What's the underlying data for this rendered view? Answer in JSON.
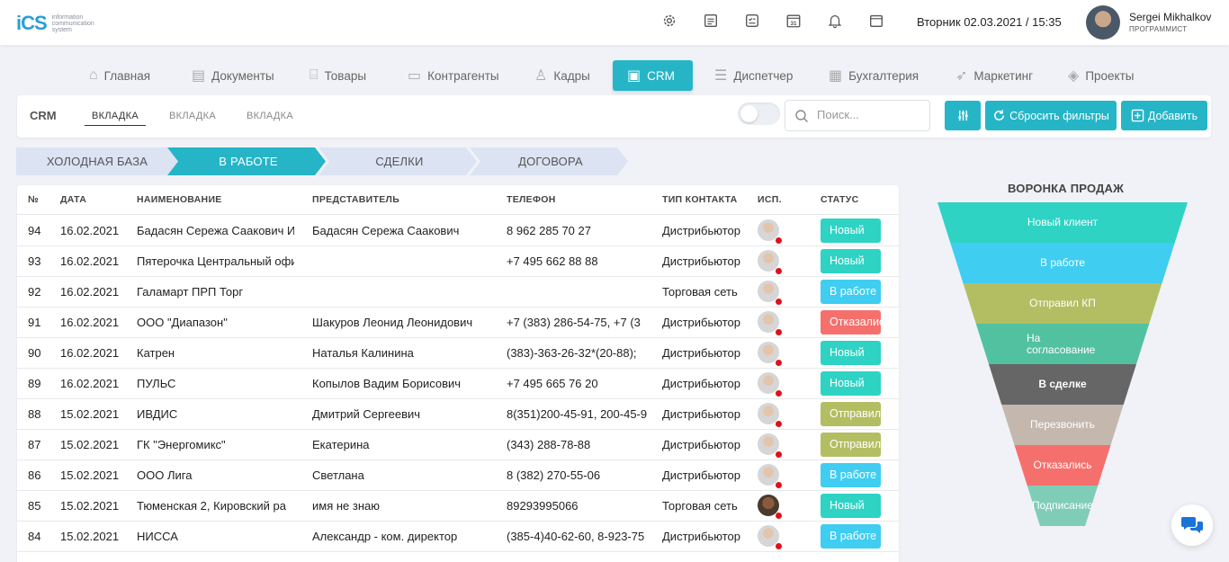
{
  "header": {
    "logo_mark": "iCS",
    "logo_lines": [
      "information",
      "communication",
      "system"
    ],
    "icons": [
      "settings-icon",
      "document-icon",
      "checklist-icon",
      "calendar-icon",
      "bell-icon",
      "window-icon"
    ],
    "calendar_day": "31",
    "datetime": "Вторник 02.03.2021 / 15:35",
    "user_name": "Sergei Mikhalkov",
    "user_role": "ПРОГРАММИСТ"
  },
  "nav": {
    "items": [
      {
        "label": "Главная",
        "icon": "home-icon"
      },
      {
        "label": "Документы",
        "icon": "documents-icon"
      },
      {
        "label": "Товары",
        "icon": "box-icon"
      },
      {
        "label": "Контрагенты",
        "icon": "briefcase-icon"
      },
      {
        "label": "Кадры",
        "icon": "people-icon"
      },
      {
        "label": "CRM",
        "icon": "monitor-icon",
        "active": true
      },
      {
        "label": "Диспетчер",
        "icon": "list-icon"
      },
      {
        "label": "Бухгалтерия",
        "icon": "calculator-icon"
      },
      {
        "label": "Маркетинг",
        "icon": "rocket-icon"
      },
      {
        "label": "Проекты",
        "icon": "layers-icon"
      }
    ]
  },
  "toolbar": {
    "title": "CRM",
    "tabs": [
      "ВКЛАДКА",
      "ВКЛАДКА",
      "ВКЛАДКА"
    ],
    "search_placeholder": "Поиск...",
    "reset_label": "Сбросить фильтры",
    "add_label": "Добавить"
  },
  "stages": [
    "ХОЛОДНАЯ БАЗА",
    "В РАБОТЕ",
    "СДЕЛКИ",
    "ДОГОВОРА"
  ],
  "table": {
    "columns": [
      "№",
      "ДАТА",
      "НАИМЕНОВАНИЕ",
      "ПРЕДСТАВИТЕЛЬ",
      "ТЕЛЕФОН",
      "ТИП КОНТАКТА",
      "ИСП.",
      "СТАТУС"
    ],
    "rows": [
      {
        "no": "94",
        "date": "16.02.2021",
        "name": "Бадасян Сережа Саакович И",
        "rep": "Бадасян Сережа Саакович",
        "phone": "8 962 285 70 27",
        "type": "Дистрибьютор",
        "status": "Новый",
        "status_color": "#2ed3c4"
      },
      {
        "no": "93",
        "date": "16.02.2021",
        "name": "Пятерочка Центральный офи",
        "rep": "",
        "phone": "+7 495 662 88 88",
        "type": "Дистрибьютор",
        "status": "Новый",
        "status_color": "#2ed3c4"
      },
      {
        "no": "92",
        "date": "16.02.2021",
        "name": "Галамарт ПРП Торг",
        "rep": "",
        "phone": "",
        "type": "Торговая сеть",
        "status": "В работе",
        "status_color": "#3fcdf1"
      },
      {
        "no": "91",
        "date": "16.02.2021",
        "name": "ООО \"Диапазон\"",
        "rep": "Шакуров Леонид Леонидович",
        "phone": "+7 (383) 286-54-75, +7 (3",
        "type": "Дистрибьютор",
        "status": "Отказались",
        "status_color": "#f5706c"
      },
      {
        "no": "90",
        "date": "16.02.2021",
        "name": "Катрен",
        "rep": "Наталья Калинина",
        "phone": "(383)-363-26-32*(20-88);",
        "type": "Дистрибьютор",
        "status": "Новый",
        "status_color": "#2ed3c4"
      },
      {
        "no": "89",
        "date": "16.02.2021",
        "name": "ПУЛЬС",
        "rep": "Копылов Вадим Борисович",
        "phone": "+7 495 665 76 20",
        "type": "Дистрибьютор",
        "status": "Новый",
        "status_color": "#2ed3c4"
      },
      {
        "no": "88",
        "date": "15.02.2021",
        "name": "ИВДИС",
        "rep": "Дмитрий Сергеевич",
        "phone": "8(351)200-45-91, 200-45-9",
        "type": "Дистрибьютор",
        "status": "Отправил КП",
        "status_color": "#b3be63"
      },
      {
        "no": "87",
        "date": "15.02.2021",
        "name": "ГК \"Энергомикс\"",
        "rep": "Екатерина",
        "phone": "(343) 288-78-88",
        "type": "Дистрибьютор",
        "status": "Отправил КП",
        "status_color": "#b3be63"
      },
      {
        "no": "86",
        "date": "15.02.2021",
        "name": "ООО Лига",
        "rep": "Светлана",
        "phone": "8 (382) 270-55-06",
        "type": "Дистрибьютор",
        "status": "В работе",
        "status_color": "#3fcdf1"
      },
      {
        "no": "85",
        "date": "15.02.2021",
        "name": "Тюменская 2, Кировский ра",
        "rep": "имя не знаю",
        "phone": "89293995066",
        "type": "Торговая сеть",
        "status": "Новый",
        "status_color": "#2ed3c4",
        "dark_avatar": true
      },
      {
        "no": "84",
        "date": "15.02.2021",
        "name": "НИССА",
        "rep": "Александр - ком. директор",
        "phone": "(385-4)40-62-60, 8-923-75",
        "type": "Дистрибьютор",
        "status": "В работе",
        "status_color": "#3fcdf1"
      }
    ]
  },
  "funnel": {
    "title": "ВОРОНКА ПРОДАЖ",
    "stages": [
      {
        "label": "Новый клиент",
        "color": "#2ed3c4"
      },
      {
        "label": "В работе",
        "color": "#3fcdf1"
      },
      {
        "label": "Отправил КП",
        "color": "#b3be63"
      },
      {
        "label": "На согласование",
        "color": "#52c1a0"
      },
      {
        "label": "В сделке",
        "color": "#666666"
      },
      {
        "label": "Перезвонить",
        "color": "#c3b7ae"
      },
      {
        "label": "Отказались",
        "color": "#f5706c"
      },
      {
        "label": "Подписание",
        "color": "#7fcdb7"
      }
    ]
  }
}
